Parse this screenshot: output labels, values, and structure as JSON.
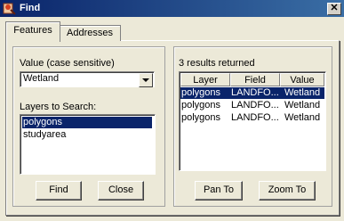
{
  "window": {
    "title": "Find",
    "close_glyph": "✕"
  },
  "tabs": [
    {
      "label": "Features",
      "active": true
    },
    {
      "label": "Addresses",
      "active": false
    }
  ],
  "left": {
    "value_label": "Value (case sensitive)",
    "value": "Wetland",
    "layers_label": "Layers to Search:",
    "layers": [
      "polygons",
      "studyarea"
    ],
    "selected_layer_index": 0,
    "find_label": "Find",
    "close_label": "Close"
  },
  "right": {
    "results_label": "3 results returned",
    "columns": [
      "Layer",
      "Field",
      "Value"
    ],
    "rows": [
      [
        "polygons",
        "LANDFO...",
        "Wetland"
      ],
      [
        "polygons",
        "LANDFO...",
        "Wetland"
      ],
      [
        "polygons",
        "LANDFO...",
        "Wetland"
      ]
    ],
    "selected_row_index": 0,
    "pan_label": "Pan To",
    "zoom_label": "Zoom To"
  },
  "colors": {
    "selection": "#0a246a",
    "titlebar": "#0a246a",
    "face": "#ece9d8"
  }
}
